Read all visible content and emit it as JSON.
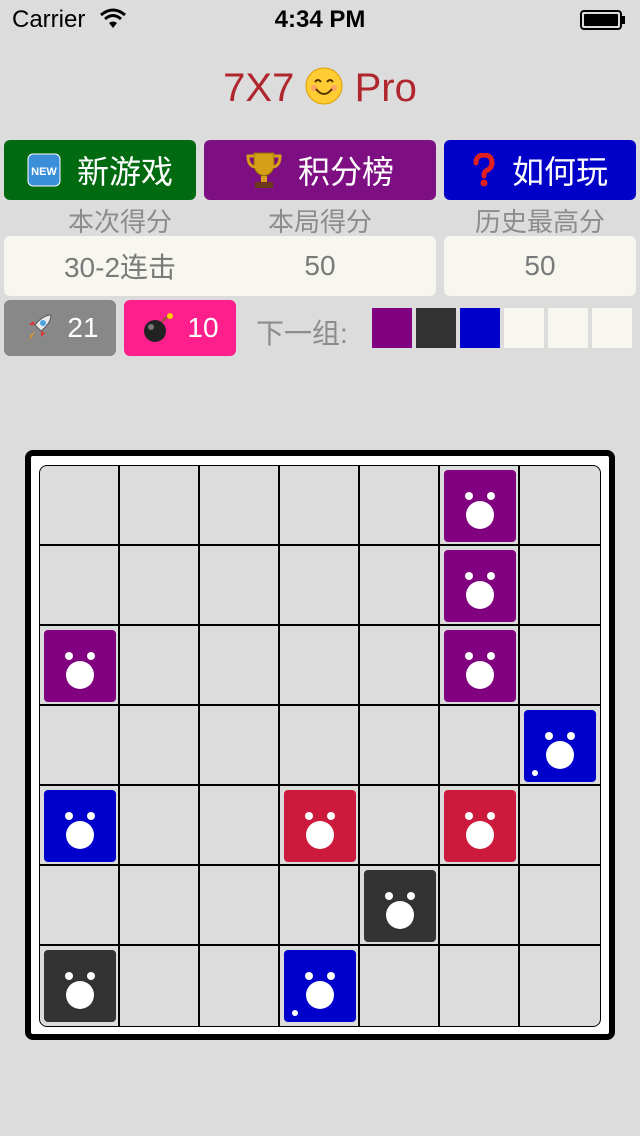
{
  "status_bar": {
    "carrier": "Carrier",
    "time": "4:34 PM"
  },
  "title": {
    "left": "7X7",
    "right": "Pro",
    "emoji": "smiling-face-icon"
  },
  "buttons": {
    "new_game": {
      "icon": "new-badge-icon",
      "label": "新游戏"
    },
    "leaderboard": {
      "icon": "trophy-icon",
      "label": "积分榜"
    },
    "how_to_play": {
      "icon": "question-mark-icon",
      "label": "如何玩"
    }
  },
  "scores": {
    "labels": [
      "本次得分",
      "本局得分",
      "历史最高分"
    ],
    "values": [
      "30-2连击",
      "50",
      "50"
    ]
  },
  "counters": {
    "rocket": {
      "icon": "rocket-icon",
      "value": "21"
    },
    "bomb": {
      "icon": "bomb-icon",
      "value": "10"
    }
  },
  "next_group": {
    "label": "下一组:",
    "colors": [
      "#800080",
      "#333333",
      "#0000cc",
      "#f7f7ef",
      "#f7f7ef",
      "#f7f7ef"
    ]
  },
  "colors": {
    "purple": "#800080",
    "blue": "#0000cc",
    "red": "#cc1a3c",
    "dark": "#333333"
  },
  "board": {
    "size": 7,
    "pieces": [
      {
        "row": 0,
        "col": 5,
        "color": "purple"
      },
      {
        "row": 1,
        "col": 5,
        "color": "purple"
      },
      {
        "row": 2,
        "col": 0,
        "color": "purple"
      },
      {
        "row": 2,
        "col": 5,
        "color": "purple"
      },
      {
        "row": 3,
        "col": 6,
        "color": "blue",
        "dot": true
      },
      {
        "row": 4,
        "col": 0,
        "color": "blue"
      },
      {
        "row": 4,
        "col": 3,
        "color": "red"
      },
      {
        "row": 4,
        "col": 5,
        "color": "red"
      },
      {
        "row": 5,
        "col": 4,
        "color": "dark"
      },
      {
        "row": 6,
        "col": 0,
        "color": "dark"
      },
      {
        "row": 6,
        "col": 3,
        "color": "blue",
        "dot": true
      }
    ]
  }
}
